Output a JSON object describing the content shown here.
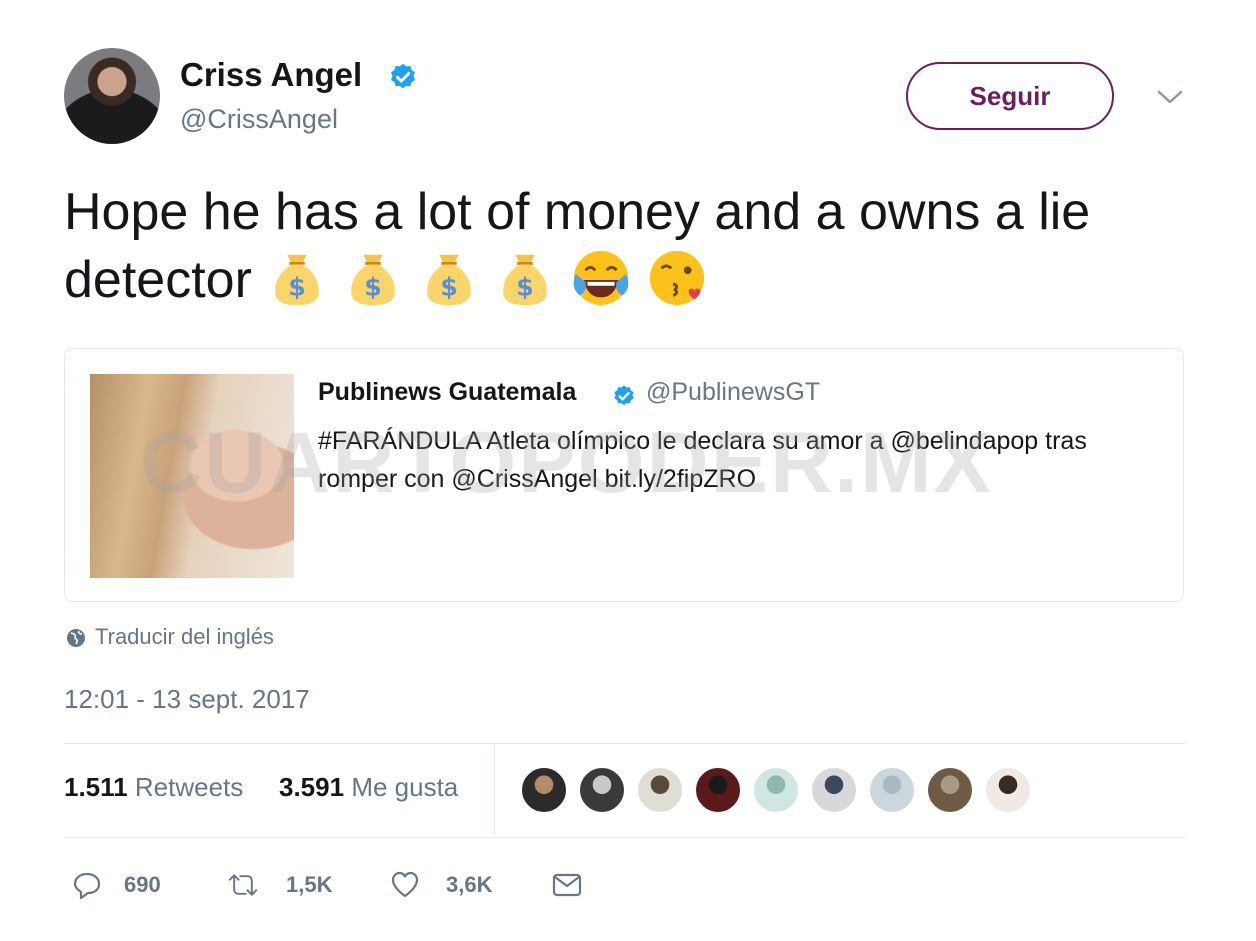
{
  "tweet": {
    "author_name": "Criss Angel",
    "author_handle": "@CrissAngel",
    "follow_label": "Seguir",
    "text": "Hope he has a lot of money and a owns a lie detector",
    "emojis": [
      "money-bag",
      "money-bag",
      "money-bag",
      "money-bag",
      "face-with-tears-of-joy",
      "face-blowing-kiss"
    ]
  },
  "quote": {
    "author_name": "Publinews Guatemala",
    "author_handle": "@PublinewsGT",
    "text": "#FARÁNDULA Atleta olímpico le declara su amor a @belindapop tras romper con @CrissAngel bit.ly/2fipZRO"
  },
  "watermark": "CUARTOPODER.MX",
  "translate_label": "Traducir del inglés",
  "timestamp": "12:01 - 13 sept. 2017",
  "stats": {
    "retweets_count": "1.511",
    "retweets_label": "Retweets",
    "likes_count": "3.591",
    "likes_label": "Me gusta"
  },
  "likers_count": 9,
  "actions": {
    "replies": "690",
    "retweets": "1,5K",
    "likes": "3,6K"
  },
  "colors": {
    "follow_accent": "#6b1f5e",
    "verified_blue": "#1da1f2",
    "secondary_text": "#657786"
  }
}
